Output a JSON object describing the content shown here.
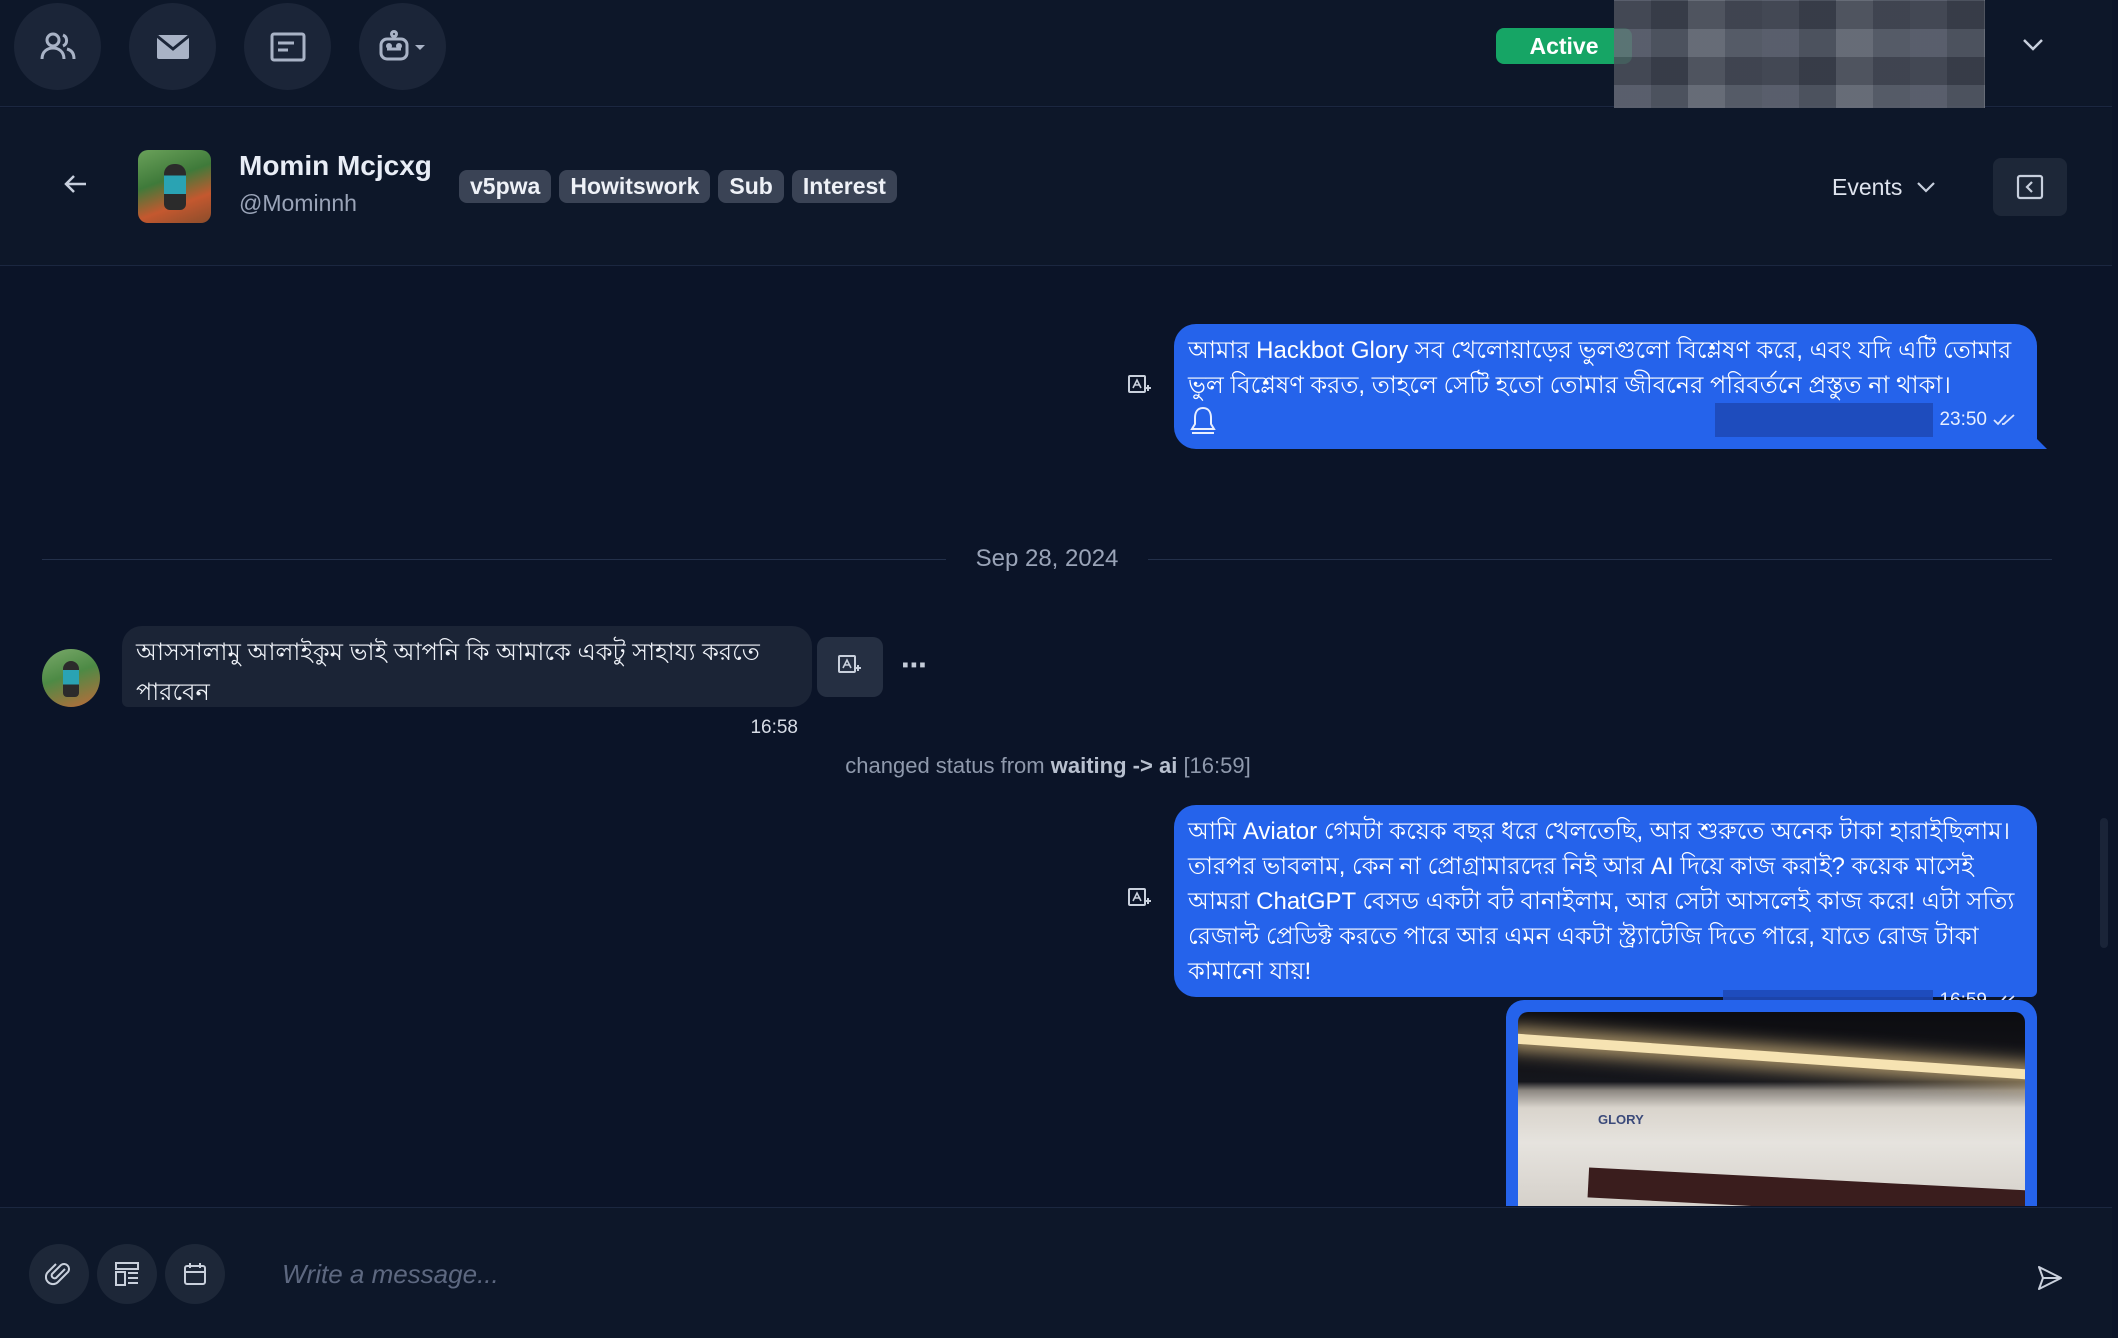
{
  "topbar": {
    "nav_icons": [
      "contacts-icon",
      "mail-icon",
      "inbox-icon",
      "bot-icon"
    ],
    "status_badge": "Active"
  },
  "contact": {
    "name": "Momin Mcjcxg",
    "handle": "@Mominnh",
    "tags": [
      "v5pwa",
      "Howitswork",
      "Sub",
      "Interest"
    ],
    "events_label": "Events"
  },
  "messages": {
    "out_1": {
      "text": "আমার Hackbot Glory সব খেলোয়াড়ের ভুলগুলো বিশ্লেষণ করে, এবং যদি এটি তোমার ভুল বিশ্লেষণ করত, তাহলে সেটি হতো তোমার জীবনের পরিবর্তনে প্রস্তুত না থাকা।",
      "time": "23:50"
    },
    "date_divider": "Sep 28, 2024",
    "in_1": {
      "text": "আসসালামু আলাইকুম ভাই আপনি কি আমাকে একটু সাহায্য করতে পারবেন",
      "time": "16:58"
    },
    "status_change": {
      "prefix": "changed status from",
      "from": "waiting",
      "arrow": "->",
      "to": "ai",
      "time": "[16:59]"
    },
    "out_2": {
      "text": "আমি Aviator গেমটা কয়েক বছর ধরে খেলতেছি, আর শুরুতে অনেক টাকা হারাইছিলাম। তারপর ভাবলাম, কেন না প্রোগ্রামারদের নিই আর AI দিয়ে কাজ করাই? কয়েক মাসেই আমরা ChatGPT বেসড একটা বট বানাইলাম, আর সেটা আসলেই কাজ করে! এটা সত্যি রেজাল্ট প্রেডিক্ট করতে পারে আর এমন একটা স্ট্র্যাটেজি দিতে পারে, যাতে রোজ টাকা কামানো যায়!",
      "time": "16:59"
    },
    "image_screen_logo": "GLORY"
  },
  "composer": {
    "placeholder": "Write a message..."
  },
  "colors": {
    "outgoing_bubble": "#2563eb",
    "incoming_bubble": "#1b2436",
    "active_badge": "#16a565",
    "background": "#0b1428"
  }
}
